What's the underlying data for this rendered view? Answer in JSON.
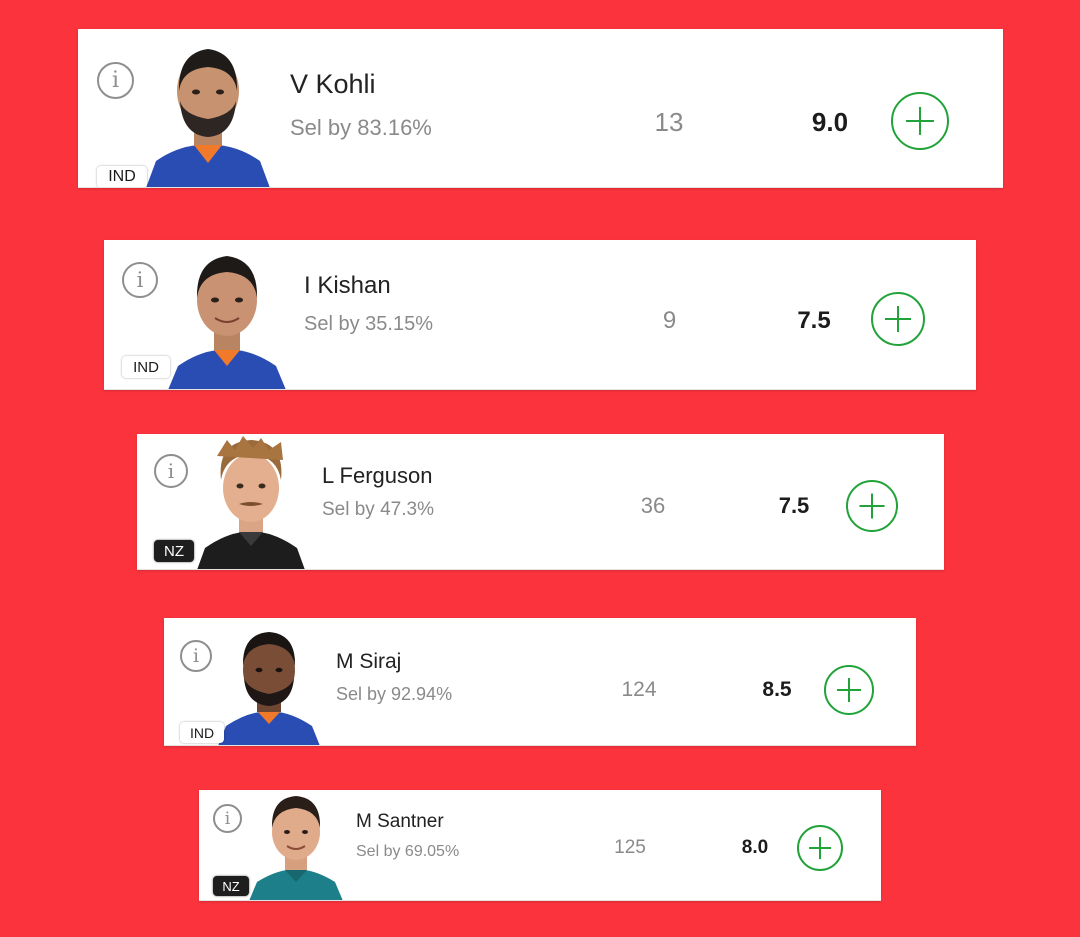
{
  "players": [
    {
      "name": "V Kohli",
      "sel_by": "Sel by 83.16%",
      "points": "13",
      "credits": "9.0",
      "team": "IND",
      "icon": "info-icon",
      "add_icon": "plus-circle-icon"
    },
    {
      "name": "I Kishan",
      "sel_by": "Sel by 35.15%",
      "points": "9",
      "credits": "7.5",
      "team": "IND",
      "icon": "info-icon",
      "add_icon": "plus-circle-icon"
    },
    {
      "name": "L Ferguson",
      "sel_by": "Sel by 47.3%",
      "points": "36",
      "credits": "7.5",
      "team": "NZ",
      "icon": "info-icon",
      "add_icon": "plus-circle-icon"
    },
    {
      "name": "M Siraj",
      "sel_by": "Sel by 92.94%",
      "points": "124",
      "credits": "8.5",
      "team": "IND",
      "icon": "info-icon",
      "add_icon": "plus-circle-icon"
    },
    {
      "name": "M Santner",
      "sel_by": "Sel by 69.05%",
      "points": "125",
      "credits": "8.0",
      "team": "NZ",
      "icon": "info-icon",
      "add_icon": "plus-circle-icon"
    }
  ],
  "colors": {
    "background": "#fb333d",
    "card": "#ffffff",
    "accent_green": "#21a33a",
    "muted_text": "#8a8a8a"
  }
}
